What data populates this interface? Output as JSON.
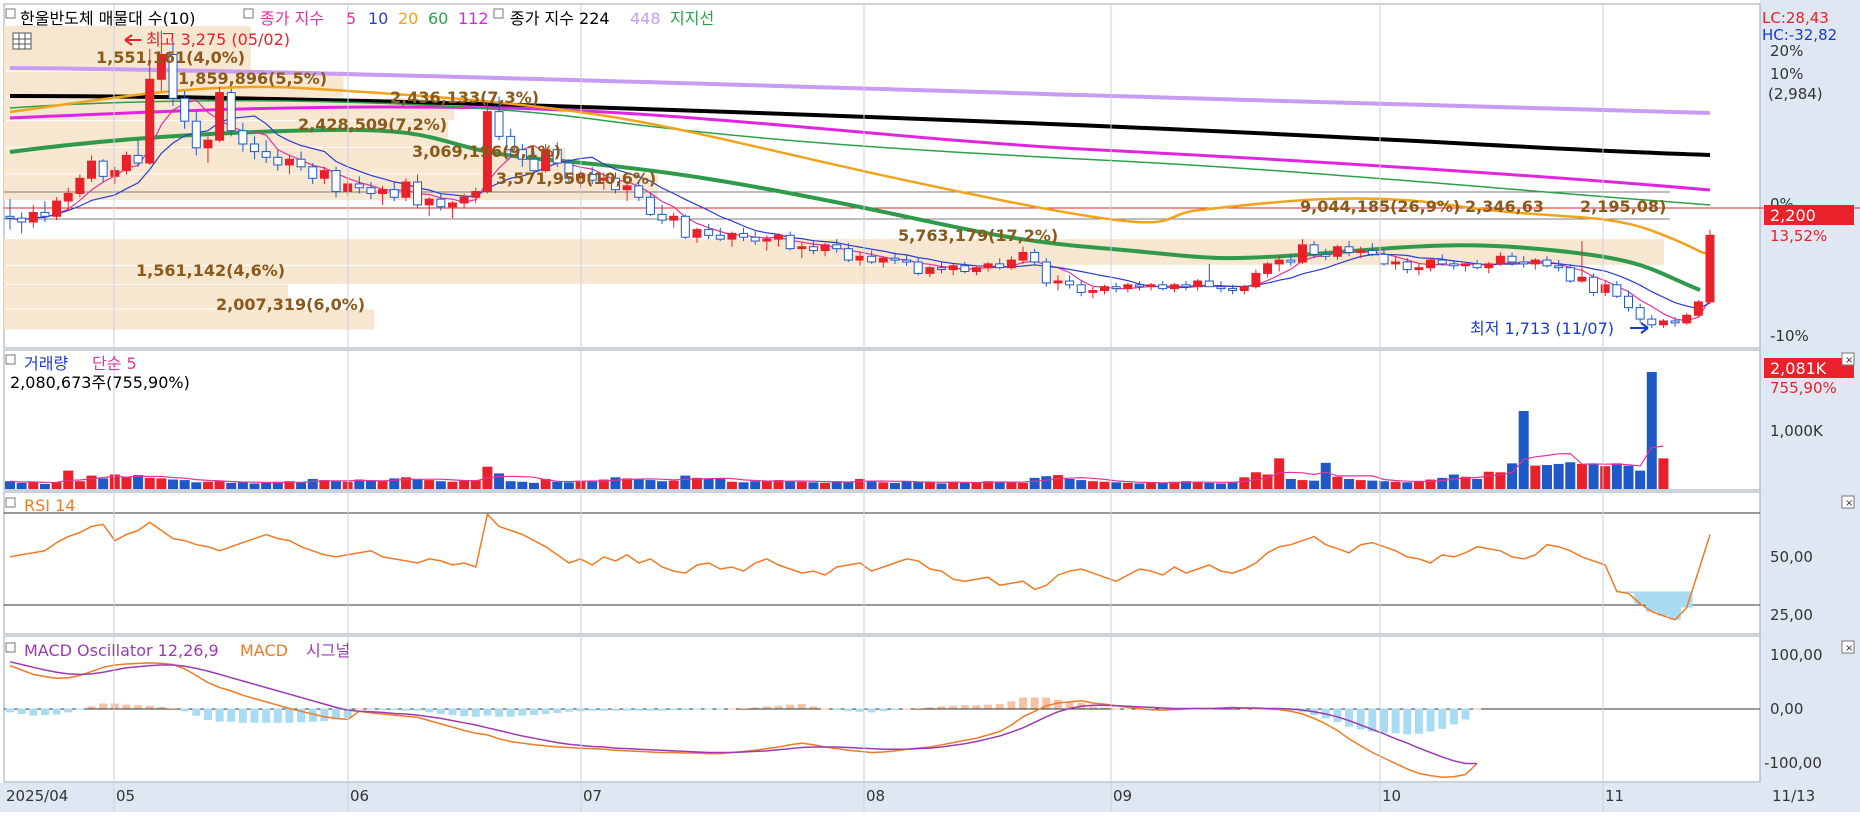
{
  "legend": {
    "main_title": "한울반도체 매물대 수(10)",
    "ma_label": "종가 지수",
    "ma_periods": [
      "5",
      "10",
      "20",
      "60",
      "112"
    ],
    "ma_long_label": "종가 지수 224",
    "ma_extra": "448",
    "support_label": "지지선"
  },
  "price_panel": {
    "high_label": "최고 3,275 (05/02)",
    "low_label": "최저 1,713 (11/07)",
    "last_price": "2,200",
    "last_change": "13,52%",
    "lc": "LC:28,43",
    "hc": "HC:-32,82",
    "right_ticks": [
      "20%",
      "10%",
      "(2,984)",
      "0%",
      "-10%"
    ],
    "volume_profile": [
      {
        "label": "1,551,161(4,0%)",
        "pct": 4.0
      },
      {
        "label": "1,859,896(5,5%)",
        "pct": 5.5
      },
      {
        "label": "2,436,133(7,3%)",
        "pct": 7.3
      },
      {
        "label": "2,428,509(7,2%)",
        "pct": 7.2
      },
      {
        "label": "3,069,196(9,1%)",
        "pct": 9.1
      },
      {
        "label": "3,571,956(10,6%)",
        "pct": 10.6
      },
      {
        "label": "9,044,185(26,9%)",
        "pct": 26.9
      },
      {
        "label": "2,346,63",
        "pct": 7.0
      },
      {
        "label": "2,195,08)",
        "pct": 6.5
      },
      {
        "label": "5,763,179(17,2%)",
        "pct": 17.2
      },
      {
        "label": "1,561,142(4,6%)",
        "pct": 4.6
      },
      {
        "label": "2,007,319(6,0%)",
        "pct": 6.0
      }
    ]
  },
  "volume_panel": {
    "title": "거래량",
    "ma_label": "단순 5",
    "info": "2,080,673주(755,90%)",
    "last_badge": "2,081K",
    "last_pct": "755,90%",
    "tick": "1,000K"
  },
  "rsi_panel": {
    "title": "RSI 14",
    "ticks": [
      "50,00",
      "25,00"
    ]
  },
  "macd_panel": {
    "title": "MACD Oscillator 12,26,9",
    "macd_label": "MACD",
    "signal_label": "시그널",
    "ticks": [
      "100,00",
      "0,00",
      "-100,00"
    ]
  },
  "x_axis": {
    "labels": [
      "2025/04",
      "05",
      "06",
      "07",
      "08",
      "09",
      "10",
      "11"
    ],
    "end_label": "11/13"
  },
  "colors": {
    "up": "#e8212a",
    "down": "#1f58c8",
    "ma5": "#e3349c",
    "ma10": "#2b3bd3",
    "ma20": "#f2a21b",
    "ma60": "#2aa14a",
    "ma112": "#e025e0",
    "ma224": "#000000",
    "ma448": "#c79cf2",
    "support": "#2e9a4a",
    "rsi": "#f07a25",
    "macd": "#f07a25",
    "signal": "#9a3cb0",
    "osc_pos": "#f6c1a4",
    "osc_neg": "#a9dcf2",
    "profile": "#f7e6d0"
  },
  "chart_data": {
    "type": "candlestick",
    "price_range": [
      1650,
      3300
    ],
    "candles": [
      [
        2300,
        2390,
        2230,
        2290
      ],
      [
        2290,
        2320,
        2210,
        2270
      ],
      [
        2270,
        2360,
        2240,
        2320
      ],
      [
        2320,
        2380,
        2270,
        2300
      ],
      [
        2300,
        2400,
        2280,
        2380
      ],
      [
        2380,
        2450,
        2330,
        2420
      ],
      [
        2420,
        2520,
        2400,
        2500
      ],
      [
        2500,
        2620,
        2480,
        2590
      ],
      [
        2590,
        2600,
        2480,
        2510
      ],
      [
        2510,
        2560,
        2470,
        2540
      ],
      [
        2540,
        2640,
        2520,
        2620
      ],
      [
        2620,
        2700,
        2560,
        2580
      ],
      [
        2580,
        3180,
        2570,
        3020
      ],
      [
        3020,
        3275,
        2960,
        3150
      ],
      [
        3150,
        3220,
        2880,
        2920
      ],
      [
        2920,
        2960,
        2760,
        2800
      ],
      [
        2800,
        2850,
        2620,
        2660
      ],
      [
        2660,
        2720,
        2580,
        2700
      ],
      [
        2700,
        2980,
        2690,
        2950
      ],
      [
        2950,
        2970,
        2720,
        2750
      ],
      [
        2750,
        2790,
        2640,
        2680
      ],
      [
        2680,
        2720,
        2600,
        2640
      ],
      [
        2640,
        2700,
        2580,
        2610
      ],
      [
        2610,
        2650,
        2540,
        2570
      ],
      [
        2570,
        2620,
        2520,
        2600
      ],
      [
        2600,
        2640,
        2540,
        2560
      ],
      [
        2560,
        2580,
        2470,
        2500
      ],
      [
        2500,
        2560,
        2470,
        2540
      ],
      [
        2540,
        2560,
        2400,
        2430
      ],
      [
        2430,
        2500,
        2410,
        2470
      ],
      [
        2470,
        2510,
        2420,
        2450
      ],
      [
        2450,
        2480,
        2390,
        2420
      ],
      [
        2420,
        2460,
        2360,
        2440
      ],
      [
        2440,
        2480,
        2380,
        2400
      ],
      [
        2400,
        2500,
        2380,
        2480
      ],
      [
        2480,
        2520,
        2340,
        2360
      ],
      [
        2360,
        2400,
        2300,
        2390
      ],
      [
        2390,
        2420,
        2330,
        2350
      ],
      [
        2350,
        2380,
        2290,
        2370
      ],
      [
        2370,
        2420,
        2340,
        2400
      ],
      [
        2400,
        2450,
        2370,
        2430
      ],
      [
        2430,
        2900,
        2420,
        2850
      ],
      [
        2850,
        2930,
        2700,
        2720
      ],
      [
        2720,
        2760,
        2610,
        2650
      ],
      [
        2650,
        2680,
        2560,
        2600
      ],
      [
        2600,
        2640,
        2520,
        2540
      ],
      [
        2540,
        2680,
        2530,
        2650
      ],
      [
        2650,
        2690,
        2560,
        2580
      ],
      [
        2580,
        2600,
        2480,
        2500
      ],
      [
        2500,
        2540,
        2450,
        2520
      ],
      [
        2520,
        2560,
        2470,
        2490
      ],
      [
        2490,
        2530,
        2440,
        2500
      ],
      [
        2500,
        2530,
        2420,
        2440
      ],
      [
        2440,
        2480,
        2380,
        2460
      ],
      [
        2460,
        2490,
        2380,
        2400
      ],
      [
        2400,
        2420,
        2300,
        2310
      ],
      [
        2310,
        2360,
        2260,
        2280
      ],
      [
        2280,
        2320,
        2240,
        2300
      ],
      [
        2300,
        2310,
        2180,
        2190
      ],
      [
        2190,
        2240,
        2160,
        2230
      ],
      [
        2230,
        2260,
        2180,
        2200
      ],
      [
        2200,
        2240,
        2170,
        2180
      ],
      [
        2180,
        2220,
        2140,
        2210
      ],
      [
        2210,
        2240,
        2170,
        2190
      ],
      [
        2190,
        2220,
        2150,
        2170
      ],
      [
        2170,
        2200,
        2120,
        2180
      ],
      [
        2180,
        2210,
        2140,
        2200
      ],
      [
        2200,
        2220,
        2120,
        2130
      ],
      [
        2130,
        2160,
        2080,
        2140
      ],
      [
        2140,
        2170,
        2100,
        2120
      ],
      [
        2120,
        2160,
        2090,
        2150
      ],
      [
        2150,
        2180,
        2110,
        2130
      ],
      [
        2130,
        2160,
        2060,
        2070
      ],
      [
        2070,
        2110,
        2040,
        2090
      ],
      [
        2090,
        2120,
        2050,
        2060
      ],
      [
        2060,
        2090,
        2030,
        2080
      ],
      [
        2080,
        2110,
        2050,
        2070
      ],
      [
        2070,
        2100,
        2040,
        2060
      ],
      [
        2060,
        2080,
        1990,
        2000
      ],
      [
        2000,
        2040,
        1980,
        2030
      ],
      [
        2030,
        2060,
        2000,
        2020
      ],
      [
        2020,
        2050,
        1990,
        2040
      ],
      [
        2040,
        2060,
        2000,
        2010
      ],
      [
        2010,
        2040,
        1990,
        2030
      ],
      [
        2030,
        2060,
        2010,
        2050
      ],
      [
        2050,
        2080,
        2020,
        2030
      ],
      [
        2030,
        2090,
        2020,
        2070
      ],
      [
        2070,
        2140,
        2050,
        2110
      ],
      [
        2110,
        2130,
        2040,
        2060
      ],
      [
        2060,
        2080,
        1930,
        1950
      ],
      [
        1950,
        1990,
        1910,
        1960
      ],
      [
        1960,
        1990,
        1920,
        1940
      ],
      [
        1940,
        1960,
        1880,
        1900
      ],
      [
        1900,
        1930,
        1870,
        1910
      ],
      [
        1910,
        1940,
        1890,
        1930
      ],
      [
        1930,
        1950,
        1900,
        1920
      ],
      [
        1920,
        1950,
        1900,
        1940
      ],
      [
        1940,
        1960,
        1910,
        1930
      ],
      [
        1930,
        1950,
        1910,
        1940
      ],
      [
        1940,
        1960,
        1910,
        1920
      ],
      [
        1920,
        1950,
        1900,
        1940
      ],
      [
        1940,
        1960,
        1910,
        1930
      ],
      [
        1930,
        1970,
        1910,
        1960
      ],
      [
        1960,
        2050,
        1940,
        1930
      ],
      [
        1930,
        1960,
        1900,
        1920
      ],
      [
        1920,
        1940,
        1890,
        1910
      ],
      [
        1910,
        1940,
        1890,
        1930
      ],
      [
        1930,
        2020,
        1920,
        2000
      ],
      [
        2000,
        2060,
        1980,
        2050
      ],
      [
        2050,
        2090,
        2010,
        2070
      ],
      [
        2070,
        2100,
        2040,
        2060
      ],
      [
        2060,
        2180,
        2050,
        2150
      ],
      [
        2150,
        2170,
        2080,
        2100
      ],
      [
        2100,
        2130,
        2070,
        2090
      ],
      [
        2090,
        2150,
        2070,
        2140
      ],
      [
        2140,
        2170,
        2090,
        2110
      ],
      [
        2110,
        2140,
        2080,
        2120
      ],
      [
        2120,
        2160,
        2090,
        2100
      ],
      [
        2100,
        2130,
        2040,
        2050
      ],
      [
        2050,
        2090,
        2020,
        2060
      ],
      [
        2060,
        2080,
        2000,
        2020
      ],
      [
        2020,
        2050,
        1990,
        2030
      ],
      [
        2030,
        2080,
        2010,
        2070
      ],
      [
        2070,
        2100,
        2040,
        2050
      ],
      [
        2050,
        2070,
        2020,
        2040
      ],
      [
        2040,
        2060,
        2010,
        2050
      ],
      [
        2050,
        2070,
        2020,
        2030
      ],
      [
        2030,
        2060,
        2000,
        2050
      ],
      [
        2050,
        2110,
        2040,
        2090
      ],
      [
        2090,
        2110,
        2040,
        2060
      ],
      [
        2060,
        2090,
        2030,
        2050
      ],
      [
        2050,
        2080,
        2020,
        2070
      ],
      [
        2070,
        2090,
        2030,
        2040
      ],
      [
        2040,
        2070,
        2010,
        2030
      ],
      [
        2030,
        2050,
        1950,
        1960
      ],
      [
        1960,
        2170,
        1950,
        1980
      ],
      [
        1980,
        2000,
        1880,
        1900
      ],
      [
        1900,
        1960,
        1880,
        1940
      ],
      [
        1940,
        1960,
        1870,
        1880
      ],
      [
        1880,
        1910,
        1800,
        1820
      ],
      [
        1820,
        1840,
        1740,
        1760
      ],
      [
        1760,
        1780,
        1713,
        1730
      ],
      [
        1730,
        1760,
        1713,
        1750
      ],
      [
        1750,
        1770,
        1720,
        1740
      ],
      [
        1740,
        1790,
        1730,
        1780
      ],
      [
        1780,
        1860,
        1770,
        1850
      ],
      [
        1850,
        2230,
        1840,
        2200
      ]
    ],
    "volume": [
      14,
      11,
      13,
      9,
      12,
      33,
      14,
      24,
      19,
      26,
      22,
      25,
      20,
      19,
      17,
      16,
      12,
      13,
      15,
      11,
      12,
      10,
      11,
      13,
      14,
      12,
      18,
      16,
      14,
      13,
      17,
      15,
      14,
      19,
      21,
      18,
      16,
      14,
      13,
      15,
      16,
      40,
      28,
      14,
      13,
      11,
      18,
      13,
      12,
      15,
      14,
      17,
      21,
      19,
      18,
      16,
      14,
      15,
      24,
      20,
      19,
      18,
      13,
      12,
      14,
      15,
      16,
      14,
      13,
      12,
      11,
      14,
      13,
      18,
      15,
      12,
      11,
      14,
      13,
      12,
      10,
      13,
      11,
      12,
      14,
      13,
      12,
      11,
      20,
      23,
      25,
      18,
      16,
      14,
      13,
      12,
      11,
      10,
      12,
      11,
      13,
      14,
      12,
      11,
      10,
      13,
      21,
      30,
      26,
      55,
      18,
      16,
      15,
      47,
      22,
      18,
      16,
      15,
      14,
      13,
      12,
      14,
      17,
      20,
      26,
      22,
      18,
      31,
      30,
      46,
      140,
      42,
      43,
      45,
      48,
      45,
      44,
      41,
      46,
      42,
      33,
      210,
      55
    ],
    "volume_range": [
      0,
      210
    ],
    "rsi": [
      47,
      48,
      49,
      50,
      54,
      57,
      59,
      62,
      63,
      55,
      58,
      60,
      64,
      60,
      56,
      55,
      53,
      52,
      50,
      52,
      54,
      56,
      58,
      56,
      55,
      52,
      50,
      48,
      47,
      48,
      49,
      50,
      47,
      46,
      45,
      44,
      46,
      45,
      43,
      44,
      42,
      68,
      62,
      60,
      58,
      55,
      52,
      48,
      44,
      46,
      43,
      47,
      45,
      48,
      44,
      46,
      42,
      40,
      39,
      43,
      44,
      41,
      42,
      40,
      44,
      46,
      43,
      41,
      39,
      40,
      38,
      42,
      43,
      44,
      40,
      42,
      44,
      46,
      45,
      41,
      40,
      36,
      35,
      36,
      37,
      33,
      34,
      35,
      31,
      33,
      38,
      40,
      41,
      39,
      37,
      35,
      38,
      41,
      40,
      38,
      42,
      39,
      41,
      43,
      40,
      39,
      41,
      44,
      49,
      52,
      53,
      55,
      57,
      53,
      51,
      49,
      53,
      54,
      52,
      50,
      47,
      46,
      44,
      48,
      47,
      49,
      52,
      51,
      50,
      47,
      46,
      48,
      53,
      52,
      50,
      47,
      45,
      43,
      30,
      29,
      24,
      20,
      18,
      16,
      22,
      40,
      58
    ],
    "rsi_range": [
      10,
      75
    ],
    "macd": [
      78,
      70,
      62,
      58,
      55,
      56,
      60,
      67,
      75,
      79,
      81,
      82,
      83,
      82,
      80,
      72,
      60,
      47,
      38,
      32,
      24,
      18,
      12,
      6,
      0,
      -5,
      -10,
      -15,
      -18,
      -20,
      -5,
      -8,
      -10,
      -12,
      -14,
      -16,
      -22,
      -28,
      -34,
      -40,
      -45,
      -48,
      -55,
      -60,
      -63,
      -66,
      -68,
      -70,
      -71,
      -72,
      -73,
      -74,
      -76,
      -77,
      -78,
      -79,
      -80,
      -80,
      -81,
      -81,
      -82,
      -82,
      -80,
      -78,
      -76,
      -73,
      -70,
      -66,
      -63,
      -66,
      -70,
      -73,
      -76,
      -78,
      -80,
      -79,
      -77,
      -74,
      -72,
      -70,
      -66,
      -62,
      -58,
      -54,
      -48,
      -42,
      -30,
      -15,
      -5,
      5,
      10,
      12,
      14,
      10,
      8,
      5,
      2,
      0,
      -2,
      -3,
      -2,
      -1,
      0,
      0,
      1,
      2,
      1,
      0,
      -1,
      -2,
      -5,
      -10,
      -18,
      -28,
      -40,
      -55,
      -68,
      -80,
      -90,
      -100,
      -110,
      -118,
      -122,
      -125,
      -124,
      -120,
      -100
    ],
    "signal": [
      85,
      80,
      75,
      70,
      66,
      63,
      62,
      63,
      66,
      70,
      74,
      76,
      78,
      79,
      79,
      77,
      73,
      68,
      62,
      56,
      50,
      44,
      38,
      32,
      26,
      20,
      14,
      8,
      2,
      -3,
      -5,
      -6,
      -7,
      -9,
      -10,
      -12,
      -15,
      -18,
      -22,
      -26,
      -30,
      -35,
      -40,
      -45,
      -50,
      -54,
      -58,
      -62,
      -65,
      -67,
      -69,
      -70,
      -72,
      -73,
      -74,
      -75,
      -76,
      -77,
      -78,
      -79,
      -80,
      -80,
      -80,
      -79,
      -78,
      -77,
      -75,
      -73,
      -71,
      -70,
      -70,
      -70,
      -71,
      -72,
      -73,
      -74,
      -74,
      -74,
      -73,
      -72,
      -70,
      -67,
      -64,
      -60,
      -55,
      -50,
      -43,
      -35,
      -25,
      -15,
      -6,
      0,
      4,
      6,
      6,
      5,
      4,
      3,
      2,
      1,
      0,
      0,
      0,
      0,
      0,
      1,
      1,
      1,
      0,
      0,
      -1,
      -3,
      -6,
      -10,
      -15,
      -22,
      -30,
      -38,
      -46,
      -55,
      -63,
      -72,
      -80,
      -88,
      -95,
      -100,
      -100
    ],
    "macd_range": [
      -130,
      110
    ]
  }
}
